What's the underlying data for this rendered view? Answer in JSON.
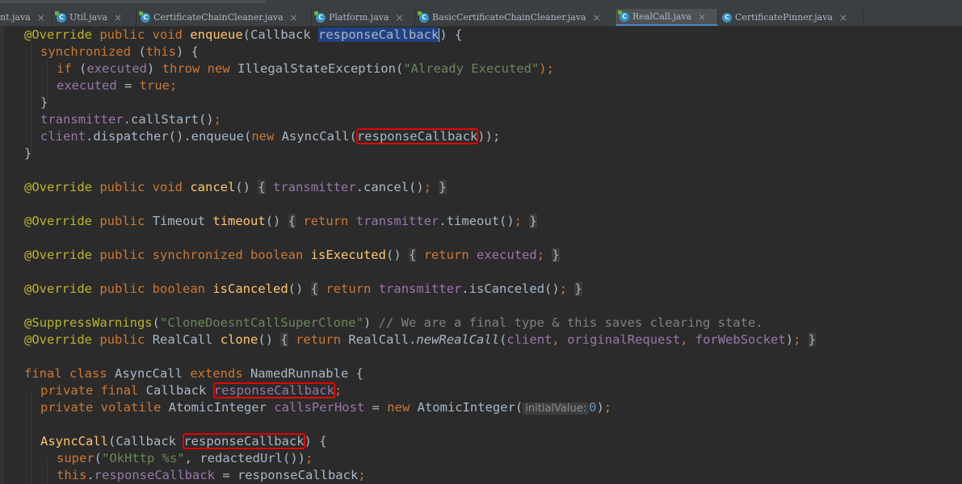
{
  "tabs": [
    {
      "label": "nt.java",
      "active": false,
      "icon": "none"
    },
    {
      "label": "Util.java",
      "active": false,
      "icon": "class-icon"
    },
    {
      "label": "CertificateChainCleaner.java",
      "active": false,
      "icon": "class-icon"
    },
    {
      "label": "Platform.java",
      "active": false,
      "icon": "class-icon"
    },
    {
      "label": "BasicCertificateChainCleaner.java",
      "active": false,
      "icon": "class-icon"
    },
    {
      "label": "RealCall.java",
      "active": true,
      "icon": "class-icon"
    },
    {
      "label": "CertificatePinner.java",
      "active": false,
      "icon": "class-icon"
    }
  ],
  "tab_close_glyph": "×",
  "code": {
    "l1": {
      "ann": "@Override",
      "kw": "public void",
      "fn": "enqueue",
      "open": "(",
      "type": "Callback",
      "param": "responseCallback",
      "close": ") {"
    },
    "l2": {
      "kw": "synchronized",
      "rest": " (",
      "this": "this",
      "close": ") {"
    },
    "l3": {
      "kw1": "if",
      "p1": " (",
      "fld": "executed",
      "p2": ") ",
      "kw2": "throw new",
      "cls": " IllegalStateException(",
      "str": "\"Already Executed\"",
      "end": ");"
    },
    "l4": {
      "fld": "executed",
      "eq": " = ",
      "kw": "true",
      "end": ";"
    },
    "l5": {
      "text": "}"
    },
    "l6": {
      "fld": "transmitter",
      "rest": ".callStart()",
      "end": ";"
    },
    "l7": {
      "fld": "client",
      "rest": ".dispatcher().enqueue(",
      "kw": "new",
      "cls": " AsyncCall(",
      "boxed": "responseCallback",
      "end": "));"
    },
    "l8": {
      "text": "}"
    },
    "l9": {
      "ann": "@Override",
      "kw": "public void",
      "fn": "cancel",
      "sig": "()",
      "fold_open": "{",
      "fld": "transmitter",
      "body": ".cancel()",
      "semi": ";",
      "fold_close": "}"
    },
    "l10": {
      "ann": "@Override",
      "kw": "public",
      "type": "Timeout",
      "fn": "timeout",
      "sig": "()",
      "fold_open": "{",
      "kw2": "return",
      "fld": "transmitter",
      "body": ".timeout()",
      "semi": ";",
      "fold_close": "}"
    },
    "l11": {
      "ann": "@Override",
      "kw": "public synchronized boolean",
      "fn": "isExecuted",
      "sig": "()",
      "fold_open": "{",
      "kw2": "return",
      "fld": "executed",
      "semi": ";",
      "fold_close": "}"
    },
    "l12": {
      "ann": "@Override",
      "kw": "public boolean",
      "fn": "isCanceled",
      "sig": "()",
      "fold_open": "{",
      "kw2": "return",
      "fld": "transmitter",
      "body": ".isCanceled()",
      "semi": ";",
      "fold_close": "}"
    },
    "l13": {
      "ann": "@SuppressWarnings",
      "open": "(",
      "str": "\"CloneDoesntCallSuperClone\"",
      "close": ")",
      "cmt": "// We are a final type & this saves clearing state."
    },
    "l14": {
      "ann": "@Override",
      "kw": "public",
      "type": "RealCall",
      "fn": "clone",
      "sig": "()",
      "fold_open": "{",
      "kw2": "return",
      "cls": "RealCall.",
      "method": "newRealCall",
      "open": "(",
      "f1": "client",
      "c1": ", ",
      "f2": "originalRequest",
      "c2": ", ",
      "f3": "forWebSocket",
      "end": ")",
      "semi": ";",
      "fold_close": "}"
    },
    "l15": {
      "kw": "final class",
      "cls": " AsyncCall ",
      "kw2": "extends",
      "rest": " NamedRunnable {"
    },
    "l16": {
      "kw": "private final",
      "type": " Callback ",
      "boxed": "responseCallback",
      "semi": ";"
    },
    "l17": {
      "kw": "private volatile",
      "type": " AtomicInteger ",
      "fld": "callsPerHost",
      "eq": " = ",
      "kw2": "new",
      "cls": " AtomicInteger(",
      "hint": "initialValue:",
      "num": "0",
      "end": ")",
      "semi": ";"
    },
    "l18": {
      "fn": "AsyncCall",
      "open": "(Callback ",
      "boxed": "responseCallback",
      "close": ") {"
    },
    "l19": {
      "kw": "super",
      "open": "(",
      "str": "\"OkHttp %s\"",
      "rest": ", redactedUrl())",
      "semi": ";"
    },
    "l20": {
      "kw": "this",
      "dot": ".",
      "fld": "responseCallback",
      "rest": " = responseCallback",
      "semi": ";"
    }
  }
}
